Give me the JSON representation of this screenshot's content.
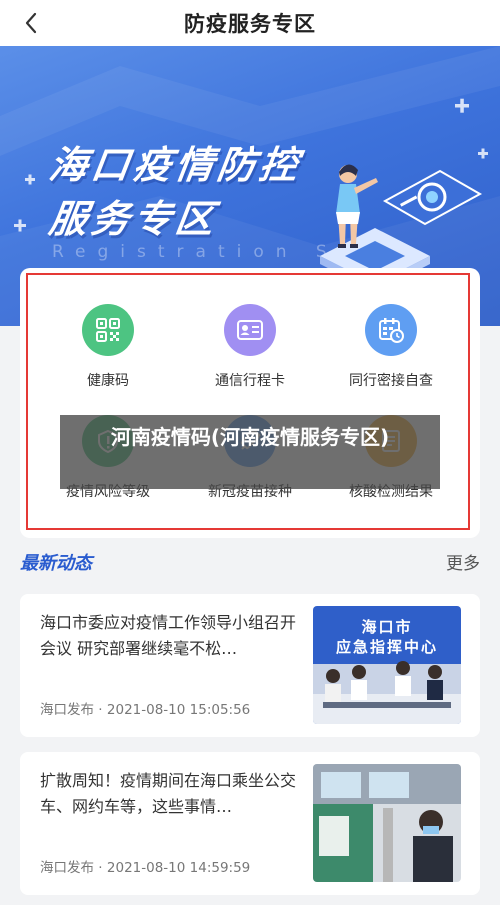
{
  "header": {
    "title": "防疫服务专区"
  },
  "banner": {
    "title_line1": "海口疫情防控",
    "title_line2": "服务专区",
    "subtitle": "Registration Sy"
  },
  "services": [
    {
      "label": "健康码",
      "icon": "qr-code-icon",
      "color": "#49c27a"
    },
    {
      "label": "通信行程卡",
      "icon": "id-card-icon",
      "color": "#9b8af0"
    },
    {
      "label": "同行密接自查",
      "icon": "calendar-clock-icon",
      "color": "#5b9bf0"
    },
    {
      "label": "疫情风险等级",
      "icon": "risk-level-icon",
      "color": "#49c27a"
    },
    {
      "label": "新冠疫苗接种",
      "icon": "vaccine-icon",
      "color": "#5b9bf0"
    },
    {
      "label": "核酸检测结果",
      "icon": "test-result-icon",
      "color": "#f5b23c"
    }
  ],
  "overlay_text": "河南疫情码(河南疫情服务专区)",
  "news_section": {
    "title": "最新动态",
    "more": "更多"
  },
  "news": [
    {
      "title": "海口市委应对疫情工作领导小组召开会议 研究部署继续毫不松…",
      "source": "海口发布",
      "date": "2021-08-10 15:05:56",
      "thumb_caption_line1": "海口市",
      "thumb_caption_line2": "应急指挥中心"
    },
    {
      "title": "扩散周知！疫情期间在海口乘坐公交车、网约车等，这些事情…",
      "source": "海口发布",
      "date": "2021-08-10 14:59:59"
    }
  ]
}
